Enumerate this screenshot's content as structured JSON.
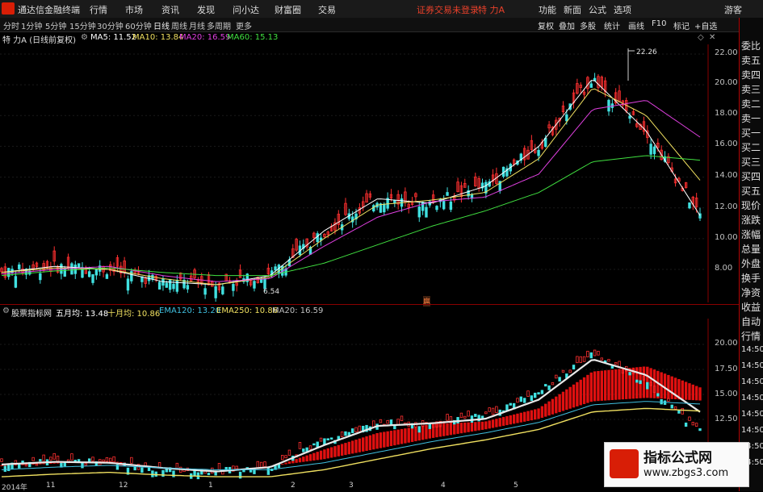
{
  "menubar": {
    "app_name": "通达信金融终端",
    "items": [
      "行情",
      "市场",
      "资讯",
      "发现",
      "问小达",
      "财富圈",
      "交易"
    ],
    "warning": "证券交易未登录",
    "stock_title": "特 力A",
    "right_items": [
      "功能",
      "新面",
      "公式",
      "选项"
    ],
    "guest": "游客"
  },
  "tabbar": {
    "periods": [
      "分时",
      "1分钟",
      "5分钟",
      "15分钟",
      "30分钟",
      "60分钟",
      "日线",
      "周线",
      "月线",
      "多周期",
      "更多"
    ],
    "active": "日线",
    "right_buttons": [
      "复权",
      "叠加",
      "多股",
      "统计",
      "画线",
      "F10",
      "标记",
      "+自选"
    ]
  },
  "main_legend": {
    "title": "特 力A (日线前复权)",
    "items": [
      {
        "label": "MA5: 11.52",
        "color": "#ffffff"
      },
      {
        "label": "MA10: 13.84",
        "color": "#f0e060"
      },
      {
        "label": "MA20: 16.59",
        "color": "#e040e0"
      },
      {
        "label": "MA60: 15.13",
        "color": "#40e040"
      }
    ]
  },
  "sub_legend": {
    "title": "股票指标网",
    "items": [
      {
        "label": "五月均: 13.48",
        "color": "#ffffff"
      },
      {
        "label": "十月均: 10.86",
        "color": "#f0e060"
      },
      {
        "label": "EMA120: 13.20",
        "color": "#40c0e0"
      },
      {
        "label": "EMA250: 10.86",
        "color": "#f0e060"
      },
      {
        "label": "MA20: 16.59",
        "color": "#c0c0c0"
      }
    ]
  },
  "price_axis": [
    "22.00",
    "20.00",
    "18.00",
    "16.00",
    "14.00",
    "12.00",
    "10.00",
    "8.00"
  ],
  "sub_axis": [
    "20.00",
    "17.50",
    "15.00",
    "12.50"
  ],
  "markers": {
    "high": "22.26",
    "low": "6.54",
    "event": "扈"
  },
  "x_axis": [
    "2014年",
    "11",
    "12",
    "1",
    "2",
    "3",
    "4",
    "5"
  ],
  "right_panel": [
    "委比",
    "卖五",
    "卖四",
    "卖三",
    "卖二",
    "卖一",
    "买一",
    "买二",
    "买三",
    "买四",
    "买五",
    "现价",
    "涨跌",
    "涨幅",
    "总量",
    "外盘",
    "换手",
    "净资",
    "收益",
    "自动",
    "行情",
    "14:50",
    "14:50",
    "14:50",
    "14:50",
    "14:50",
    "14:50",
    "14:50",
    "14:50"
  ],
  "watermark": {
    "line1": "指标公式网",
    "line2": "www.zbgs3.com"
  },
  "chart_data": {
    "type": "line",
    "title": "特 力A (日线前复权)",
    "xlabel": "",
    "ylabel": "",
    "ylim": [
      6.5,
      22.5
    ],
    "x": [
      "2014年",
      "11",
      "12",
      "1",
      "2",
      "3",
      "4",
      "5"
    ],
    "series": [
      {
        "name": "MA5",
        "values": [
          7.8,
          8.2,
          8.0,
          7.2,
          7.0,
          7.6,
          10.5,
          12.6,
          12.3,
          13.4,
          16.0,
          20.4,
          17.0,
          11.5
        ]
      },
      {
        "name": "MA10",
        "values": [
          7.8,
          8.1,
          8.0,
          7.4,
          7.0,
          7.5,
          10.0,
          12.2,
          12.5,
          13.0,
          15.2,
          19.8,
          18.0,
          13.8
        ]
      },
      {
        "name": "MA20",
        "values": [
          7.7,
          8.0,
          8.2,
          7.6,
          7.2,
          7.4,
          9.5,
          11.4,
          12.4,
          12.7,
          14.2,
          18.4,
          19.0,
          16.6
        ]
      },
      {
        "name": "MA60",
        "values": [
          7.6,
          7.9,
          8.1,
          7.8,
          7.6,
          7.6,
          8.4,
          9.6,
          10.8,
          11.8,
          13.0,
          15.0,
          15.4,
          15.1
        ]
      }
    ]
  }
}
